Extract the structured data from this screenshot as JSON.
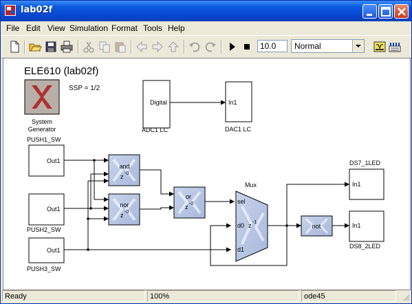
{
  "window": {
    "title": "lab02f"
  },
  "menu": [
    "File",
    "Edit",
    "View",
    "Simulation",
    "Format",
    "Tools",
    "Help"
  ],
  "toolbar": {
    "stop_time": "10.0",
    "sim_mode": "Normal"
  },
  "diagram": {
    "title": "ELE610 (lab02f)",
    "ssp": "SSP = 1/2",
    "sysgen_label_1": "System",
    "sysgen_label_2": "Generator",
    "adc_port": "Digital",
    "adc_label": "ADC1 LC",
    "dac_port": "In1",
    "dac_label": "DAC1 LC",
    "push1_label": "PUSH1_SW",
    "push2_label": "PUSH2_SW",
    "push3_label": "PUSH3_SW",
    "out_port": "Out1",
    "and_label": "and",
    "nor_label": "nor",
    "or_label": "or",
    "delay_z": "z",
    "delay_exp": "-0",
    "mux_label": "Mux",
    "mux_sel": "sel",
    "mux_d0": "d0",
    "mux_d1": "d1",
    "mux_z": "z",
    "mux_exp": "-1",
    "not_label": "not",
    "ds7_label": "DS7_1LED",
    "ds8_label": "DS8_2LED",
    "led_port": "In1"
  },
  "status": {
    "state": "Ready",
    "zoom": "100%",
    "solver": "ode45"
  }
}
